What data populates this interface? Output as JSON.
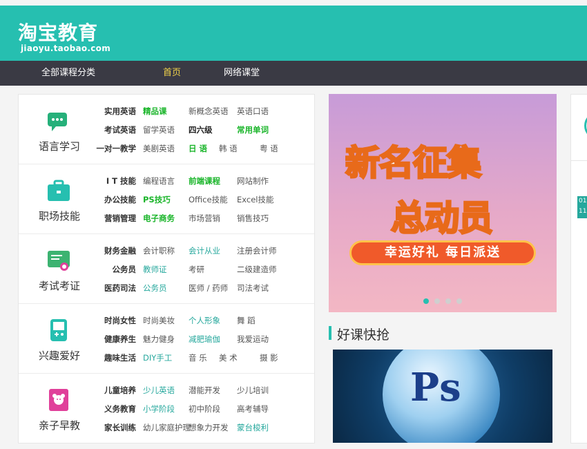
{
  "header": {
    "logo_cn": "淘宝教育",
    "logo_en": "jiaoyu.taobao.com"
  },
  "nav": {
    "items": [
      {
        "label": "全部课程分类",
        "active": false
      },
      {
        "label": "首页",
        "active": true
      },
      {
        "label": "网络课堂",
        "active": false
      }
    ]
  },
  "categories": [
    {
      "title": "语言学习",
      "icon": "chat-bubble-icon",
      "icon_color": "#26b07a",
      "rows": [
        [
          {
            "t": "实用英语",
            "s": "bold"
          },
          {
            "t": "精品课",
            "s": "green"
          },
          {
            "t": "新概念英语",
            "s": ""
          },
          {
            "t": "英语口语",
            "s": ""
          }
        ],
        [
          {
            "t": "考试英语",
            "s": "bold"
          },
          {
            "t": "留学英语",
            "s": ""
          },
          {
            "t": "四六级",
            "s": "dark"
          },
          {
            "t": "常用单词",
            "s": "green"
          }
        ],
        [
          {
            "t": "一对一教学",
            "s": "bold"
          },
          {
            "t": "美剧英语",
            "s": ""
          },
          {
            "t": "日 语",
            "s": "green"
          },
          {
            "t": "韩 语",
            "s": ""
          },
          {
            "t": "粤 语",
            "s": ""
          }
        ]
      ]
    },
    {
      "title": "职场技能",
      "icon": "briefcase-icon",
      "icon_color": "#26bfb0",
      "rows": [
        [
          {
            "t": "I T 技能",
            "s": "bold"
          },
          {
            "t": "编程语言",
            "s": ""
          },
          {
            "t": "前端课程",
            "s": "green"
          },
          {
            "t": "网站制作",
            "s": ""
          }
        ],
        [
          {
            "t": "办公技能",
            "s": "bold"
          },
          {
            "t": "PS技巧",
            "s": "green"
          },
          {
            "t": "Office技能",
            "s": ""
          },
          {
            "t": "Excel技能",
            "s": ""
          }
        ],
        [
          {
            "t": "营销管理",
            "s": "bold"
          },
          {
            "t": "电子商务",
            "s": "green"
          },
          {
            "t": "市场营销",
            "s": ""
          },
          {
            "t": "销售技巧",
            "s": ""
          }
        ]
      ]
    },
    {
      "title": "考试考证",
      "icon": "certificate-icon",
      "icon_color": "#3cb371",
      "rows": [
        [
          {
            "t": "财务金融",
            "s": "bold"
          },
          {
            "t": "会计职称",
            "s": ""
          },
          {
            "t": "会计从业",
            "s": "teal"
          },
          {
            "t": "注册会计师",
            "s": ""
          }
        ],
        [
          {
            "t": "公务员",
            "s": "bold"
          },
          {
            "t": "教师证",
            "s": "teal"
          },
          {
            "t": "考研",
            "s": ""
          },
          {
            "t": "二级建造师",
            "s": ""
          }
        ],
        [
          {
            "t": "医药司法",
            "s": "bold"
          },
          {
            "t": "公务员",
            "s": "teal"
          },
          {
            "t": "医师 / 药师",
            "s": ""
          },
          {
            "t": "司法考试",
            "s": ""
          }
        ]
      ]
    },
    {
      "title": "兴趣爱好",
      "icon": "gamepad-icon",
      "icon_color": "#26bfb0",
      "rows": [
        [
          {
            "t": "时尚女性",
            "s": "bold"
          },
          {
            "t": "时尚美妆",
            "s": ""
          },
          {
            "t": "个人形象",
            "s": "teal"
          },
          {
            "t": "舞 蹈",
            "s": ""
          }
        ],
        [
          {
            "t": "健康养生",
            "s": "bold"
          },
          {
            "t": "魅力健身",
            "s": ""
          },
          {
            "t": "减肥瑜伽",
            "s": "teal"
          },
          {
            "t": "我爱运动",
            "s": ""
          }
        ],
        [
          {
            "t": "趣味生活",
            "s": "bold"
          },
          {
            "t": "DIY手工",
            "s": "teal"
          },
          {
            "t": "音 乐",
            "s": ""
          },
          {
            "t": "美 术",
            "s": ""
          },
          {
            "t": "摄 影",
            "s": ""
          }
        ]
      ]
    },
    {
      "title": "亲子早教",
      "icon": "teddy-bear-icon",
      "icon_color": "#e0409a",
      "rows": [
        [
          {
            "t": "儿童培养",
            "s": "bold"
          },
          {
            "t": "少儿英语",
            "s": "teal"
          },
          {
            "t": "潜能开发",
            "s": ""
          },
          {
            "t": "少儿培训",
            "s": ""
          }
        ],
        [
          {
            "t": "义务教育",
            "s": "bold"
          },
          {
            "t": "小学阶段",
            "s": "teal"
          },
          {
            "t": "初中阶段",
            "s": ""
          },
          {
            "t": "高考辅导",
            "s": ""
          }
        ],
        [
          {
            "t": "家长训练",
            "s": "bold"
          },
          {
            "t": "幼儿家庭护理",
            "s": ""
          },
          {
            "t": "想象力开发",
            "s": ""
          },
          {
            "t": "蒙台梭利",
            "s": "teal"
          }
        ]
      ]
    }
  ],
  "banner": {
    "line1": "新名征集",
    "line2": "总动员",
    "ribbon": "幸运好礼 每日派送",
    "dots": 4,
    "active_dot": 0
  },
  "section": {
    "title": "好课快抢"
  },
  "course": {
    "image_label": "Ps"
  },
  "right_panel": {
    "badge": "01 11"
  },
  "colors": {
    "brand": "#26bfb0",
    "nav_bg": "#3a3a44",
    "nav_active": "#f0d24a",
    "link_green": "#1ab52a",
    "link_teal": "#26a89d"
  }
}
